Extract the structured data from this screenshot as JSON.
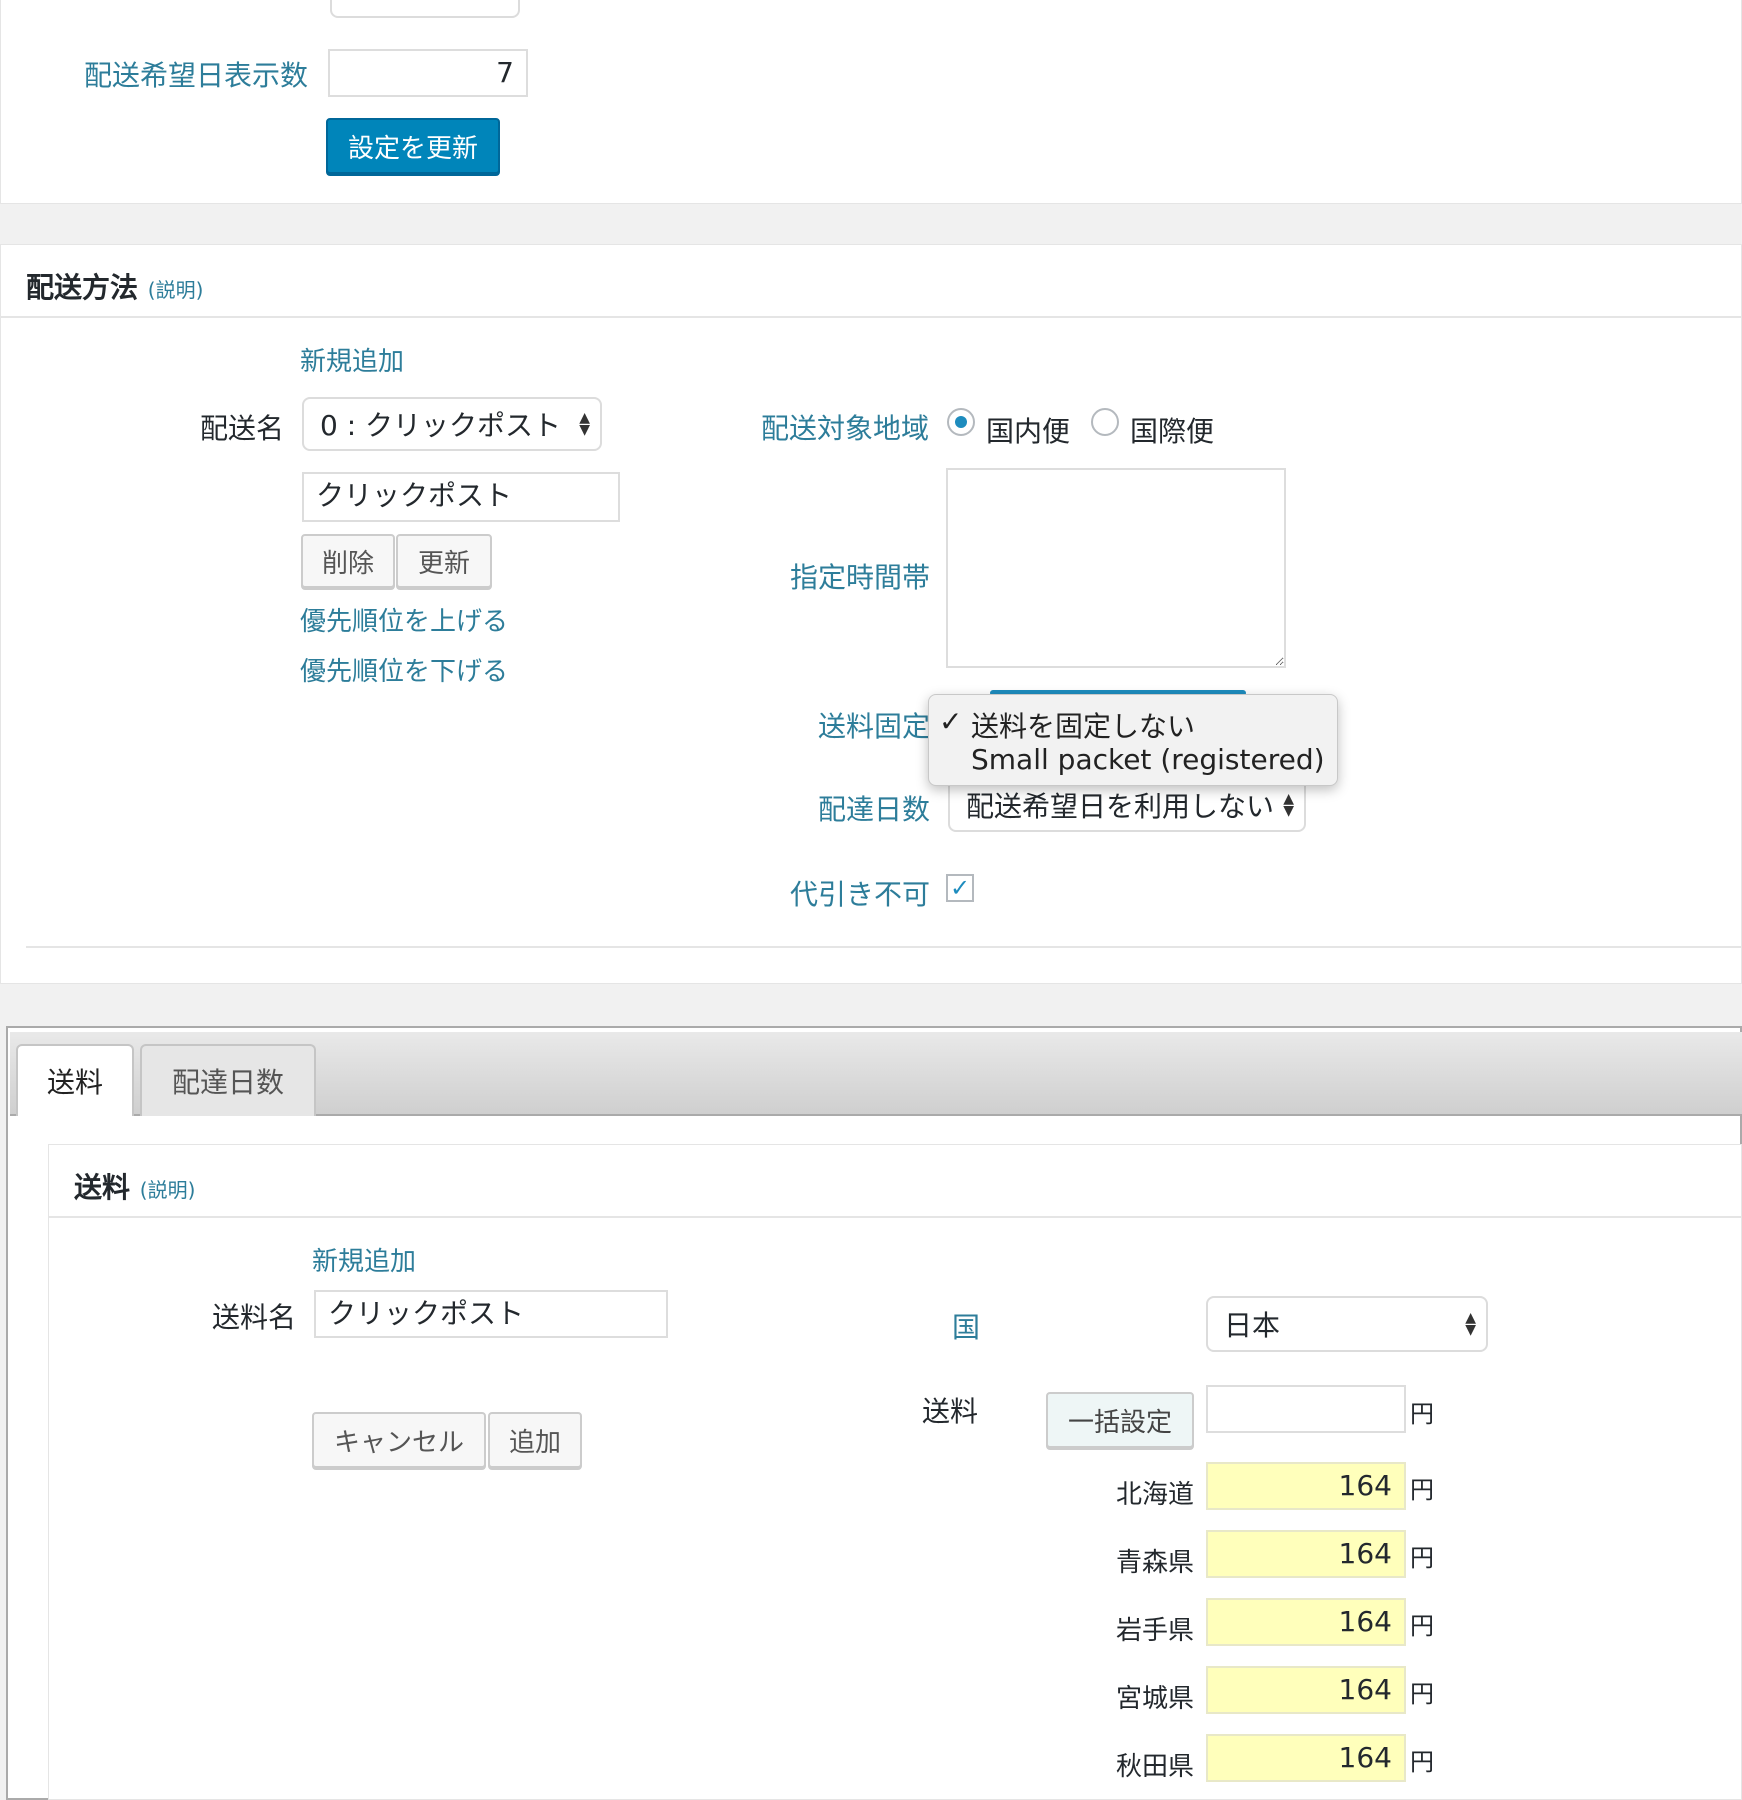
{
  "settings": {
    "delivery_days_label": "配送希望日表示数",
    "delivery_days_value": "7",
    "update_button": "設定を更新"
  },
  "shipping_method": {
    "title": "配送方法",
    "help": "(説明)",
    "add_new": "新規追加",
    "name_label": "配送名",
    "name_select": "0 : クリックポスト",
    "name_input": "クリックポスト",
    "delete_button": "削除",
    "update_button": "更新",
    "priority_up": "優先順位を上げる",
    "priority_down": "優先順位を下げる",
    "region_label": "配送対象地域",
    "region_domestic": "国内便",
    "region_international": "国際便",
    "time_label": "指定時間帯",
    "fixed_fee_label": "送料固定",
    "fixed_fee_options": [
      "送料を固定しない",
      "Small packet (registered)"
    ],
    "fixed_fee_check": "✓",
    "delivery_days_label": "配達日数",
    "delivery_days_select": "配送希望日を利用しない",
    "cod_label": "代引き不可",
    "cod_checked": "✓"
  },
  "tabs": {
    "fee": "送料",
    "days": "配達日数"
  },
  "fee_section": {
    "title": "送料",
    "help": "(説明)",
    "add_new": "新規追加",
    "name_label": "送料名",
    "name_input": "クリックポスト",
    "cancel_button": "キャンセル",
    "add_button": "追加",
    "country_label": "国",
    "country_select": "日本",
    "fee_label": "送料",
    "bulk_button": "一括設定",
    "bulk_value": "",
    "yen": "円",
    "prefectures": [
      {
        "name": "北海道",
        "fee": "164"
      },
      {
        "name": "青森県",
        "fee": "164"
      },
      {
        "name": "岩手県",
        "fee": "164"
      },
      {
        "name": "宮城県",
        "fee": "164"
      },
      {
        "name": "秋田県",
        "fee": "164"
      }
    ]
  }
}
